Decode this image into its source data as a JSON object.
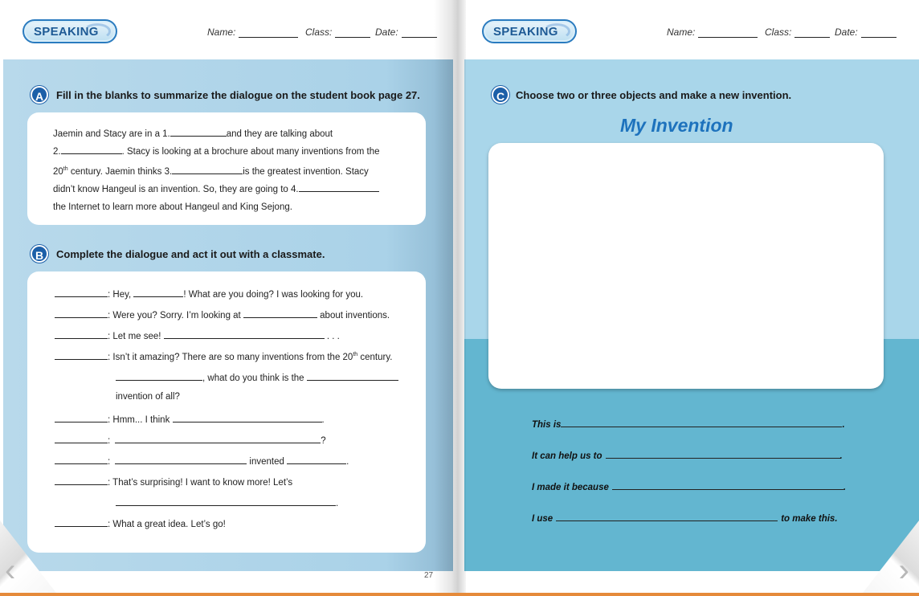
{
  "left": {
    "badge": "SPEAKING",
    "header": {
      "name_label": "Name:",
      "class_label": "Class:",
      "date_label": "Date:"
    },
    "section_a": {
      "letter": "A",
      "title": "Fill in the blanks to summarize the dialogue on the student book page 27.",
      "lines": [
        [
          "Jaemin and Stacy are in a 1.",
          "and they are talking about"
        ],
        [
          "2.",
          ". Stacy is looking at a brochure about many inventions from the"
        ],
        [
          "20",
          "th",
          " century. Jaemin thinks 3.",
          "is the greatest invention. Stacy"
        ],
        [
          "didn’t know Hangeul is an invention. So, they are going to 4.",
          ""
        ],
        [
          "the Internet to learn more about Hangeul and King Sejong."
        ]
      ]
    },
    "section_b": {
      "letter": "B",
      "title": "Complete the dialogue and act it out with a classmate.",
      "lines": {
        "l1a": ": Hey, ",
        "l1b": "! What are you doing? I was looking for you.",
        "l2a": ": Were you? Sorry. I’m looking at ",
        "l2b": " about inventions.",
        "l3a": ": Let me see! ",
        "l3b": " . . .",
        "l4a": ": Isn’t it amazing? There are so many inventions from the 20",
        "l4sup": "th",
        "l4b": " century.",
        "l5a": ", what do you think is the ",
        "l6": "invention of all?",
        "l7a": ": Hmm... I think ",
        "l7b": ".",
        "l8a": ":",
        "l8b": "?",
        "l9a": ":",
        "l9b": " invented ",
        "l9c": ".",
        "l10": ": That’s surprising! I want to know more! Let’s",
        "l11": ".",
        "l12": ": What a great idea. Let’s go!"
      }
    },
    "page_number": "27"
  },
  "right": {
    "badge": "SPEAKING",
    "header": {
      "name_label": "Name:",
      "class_label": "Class:",
      "date_label": "Date:"
    },
    "section_c": {
      "letter": "C",
      "title": "Choose two or three objects and make a new invention.",
      "heading": "My Invention",
      "sentences": {
        "s1": "This is",
        "s2": "It can help us to",
        "s3": "I made it because",
        "s4a": "I use",
        "s4b": "to make this.",
        "period": "."
      }
    }
  },
  "nav": {
    "prev": "‹",
    "next": "›"
  },
  "colors": {
    "accent": "#1c5fa8",
    "heading_blue": "#1d72bd",
    "panel_light": "#a9d6ea",
    "panel_dark": "#63b6d0",
    "bottom_strip": "#e58a3a"
  }
}
